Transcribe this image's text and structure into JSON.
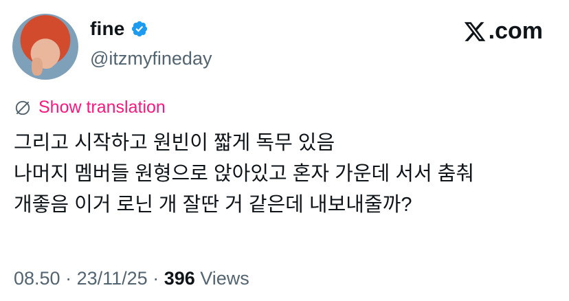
{
  "user": {
    "display_name": "fine",
    "handle": "@itzmyfineday",
    "verified_icon": "verified-badge-icon",
    "verified_color": "#1d9bf0"
  },
  "brand": {
    "logo_text": ".com",
    "logo_icon": "x-logo-icon"
  },
  "translate": {
    "label": "Show translation",
    "icon": "translate-globe-icon",
    "color": "#f91880"
  },
  "tweet": {
    "lines": [
      "그리고 시작하고 원빈이 짧게 독무 있음",
      "나머지 멤버들 원형으로 앉아있고 혼자 가운데 서서 춤춰",
      "개좋음 이거 로닌 개 잘딴 거 같은데 내보내줄까?"
    ]
  },
  "meta": {
    "time": "08.50",
    "sep1": " · ",
    "date": "23/11/25",
    "sep2": " · ",
    "views_count": "396",
    "views_label": " Views"
  }
}
